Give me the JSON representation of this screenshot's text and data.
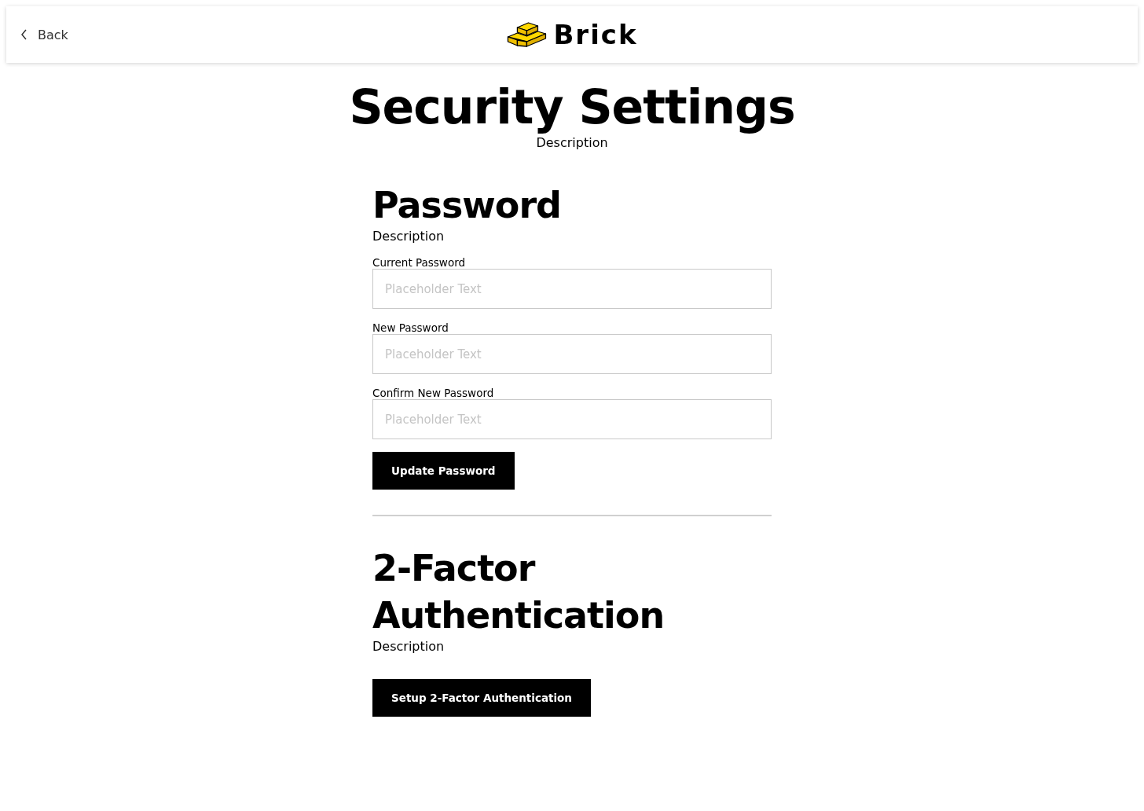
{
  "header": {
    "back_label": "Back",
    "logo_text": "Brick"
  },
  "page": {
    "title": "Security Settings",
    "description": "Description"
  },
  "sections": [
    {
      "kind": "form",
      "title": "Password",
      "description": "Description",
      "fields": [
        {
          "label": "Current Password",
          "placeholder": "Placeholder Text"
        },
        {
          "label": "New Password",
          "placeholder": "Placeholder Text"
        },
        {
          "label": "Confirm New Password",
          "placeholder": "Placeholder Text"
        }
      ],
      "button": "Update Password"
    },
    {
      "kind": "action",
      "title": "2-Factor Authentication",
      "description": "Description",
      "button": "Setup 2-Factor Authentication"
    }
  ]
}
